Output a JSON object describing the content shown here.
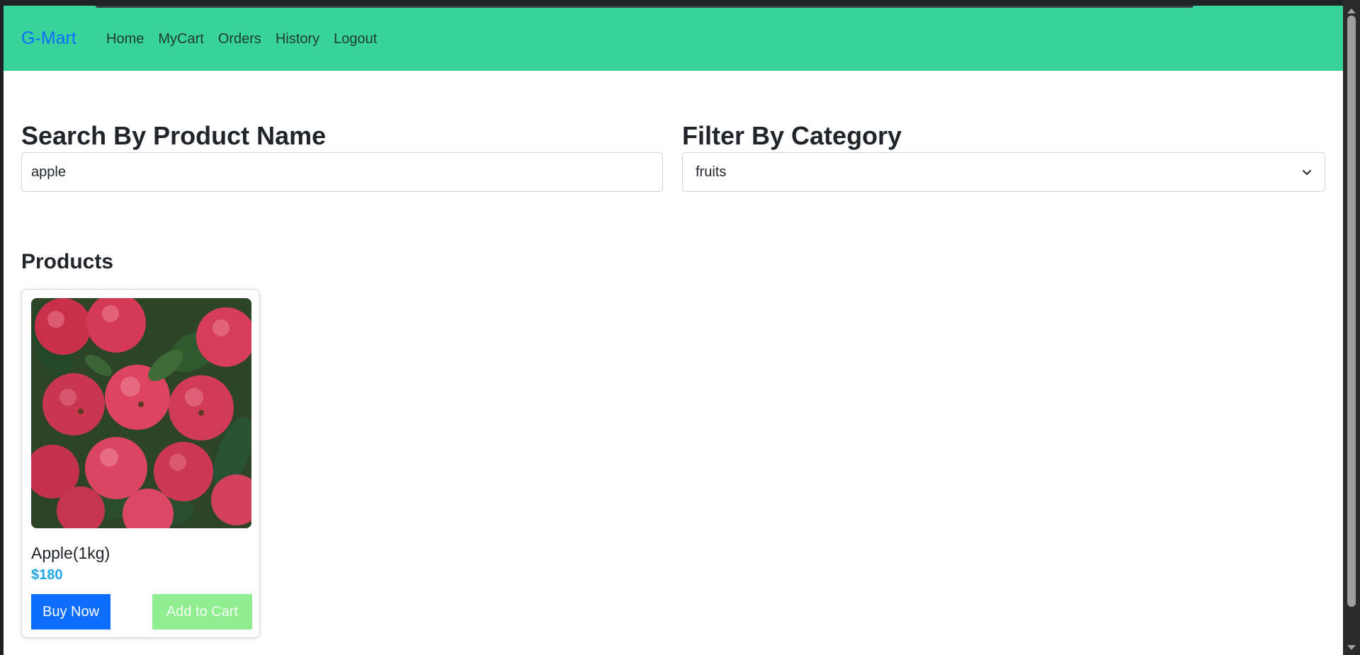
{
  "navbar": {
    "brand": "G-Mart",
    "links": [
      "Home",
      "MyCart",
      "Orders",
      "History",
      "Logout"
    ]
  },
  "search": {
    "heading": "Search By Product Name",
    "value": "apple"
  },
  "filter": {
    "heading": "Filter By Category",
    "selected": "fruits"
  },
  "products": {
    "heading": "Products",
    "items": [
      {
        "name": "Apple(1kg)",
        "price": "$180",
        "buy_label": "Buy Now",
        "cart_label": "Add to Cart"
      }
    ]
  },
  "colors": {
    "navbar": "#38d39a",
    "brand": "#0d6efd",
    "price": "#1ea7e8",
    "buy_button": "#0d6efd",
    "cart_button": "#90ee90"
  },
  "icons": {
    "select_chevron": "chevron-down-icon",
    "product_image": "apples-image"
  }
}
